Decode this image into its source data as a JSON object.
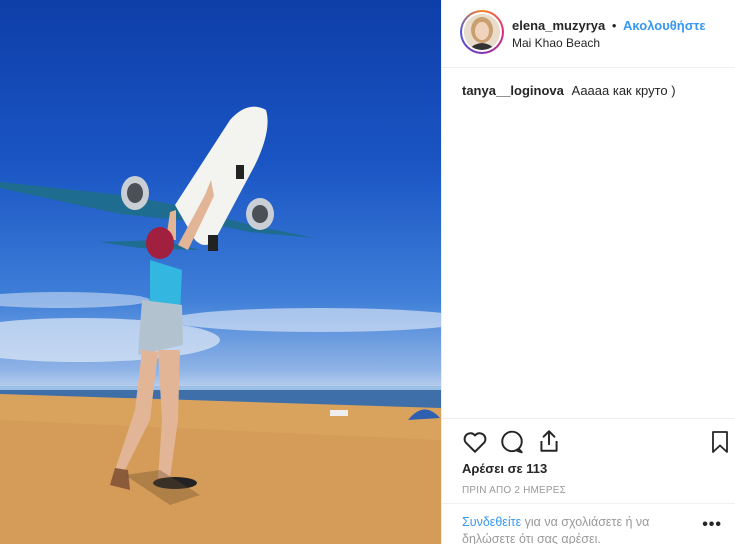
{
  "post": {
    "username": "elena_muzyrya",
    "separator": "•",
    "follow_label": "Ακολουθήστε",
    "location": "Mai Khao Beach"
  },
  "comments": [
    {
      "user": "tanya__loginova",
      "text": "Ааааа как круто )"
    }
  ],
  "actions": {
    "like_icon": "heart-icon",
    "comment_icon": "comment-icon",
    "share_icon": "share-icon",
    "save_icon": "bookmark-icon"
  },
  "likes_text": "Αρέσει σε 113",
  "time_text": "ΠΡΙΝ ΑΠΟ 2 ΗΜΕΡΕΣ",
  "login_prompt": {
    "link": "Συνδεθείτε",
    "text": " για να σχολιάσετε ή να δηλώσετε ότι σας αρέσει."
  },
  "more_label": "•••",
  "colors": {
    "accent": "#3897f0",
    "muted": "#999999",
    "sky": "#1a55c4",
    "sand": "#d9a35e"
  }
}
